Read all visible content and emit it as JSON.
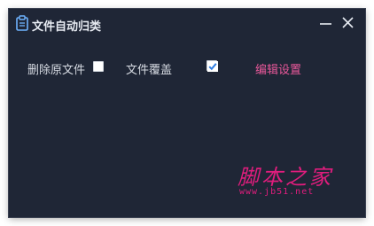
{
  "window": {
    "title": "文件自动归类",
    "icon": "clipboard-icon",
    "controls": {
      "minimize_icon": "minimize-icon",
      "close_icon": "close-icon"
    }
  },
  "options": {
    "delete_original": {
      "label": "删除原文件",
      "checked": false
    },
    "overwrite": {
      "label": "文件覆盖",
      "checked": true
    },
    "edit_settings_label": "编辑设置"
  },
  "watermark": {
    "title": "脚本之家",
    "url": "www.jb51.net"
  },
  "colors": {
    "background": "#1f2636",
    "text": "#d6dae2",
    "link": "#e9589a",
    "accent": "#2f7de1",
    "watermark": "#e01d7d"
  }
}
